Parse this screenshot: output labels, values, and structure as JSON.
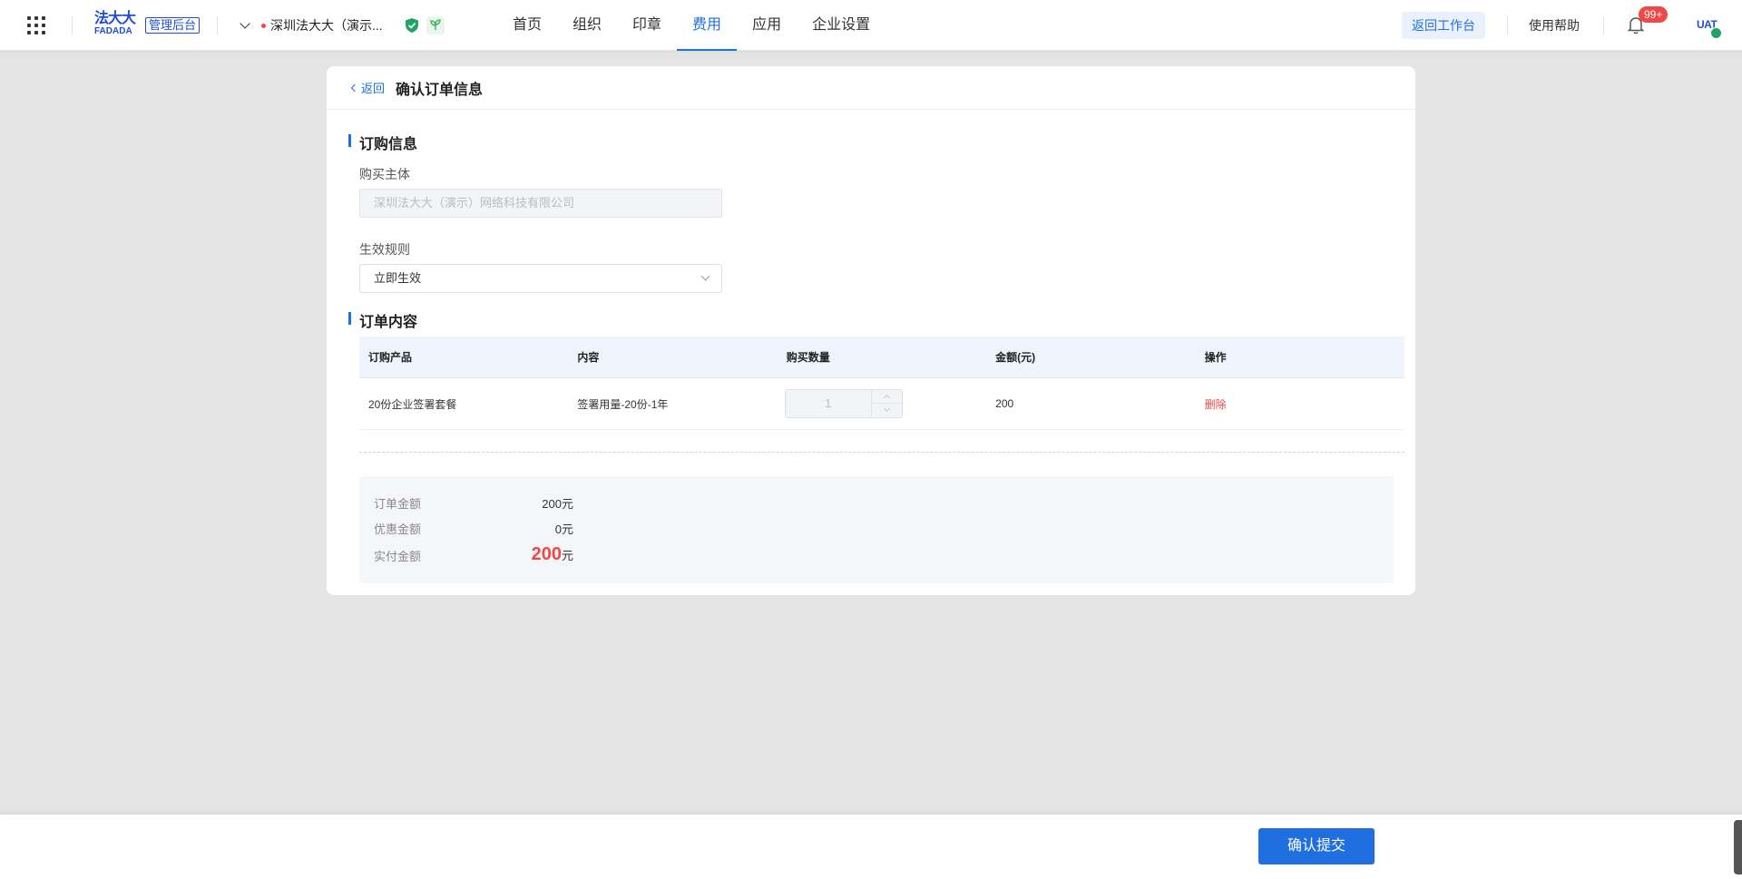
{
  "header": {
    "logo_cn": "法大大",
    "logo_en": "FADADA",
    "admin_tag": "管理后台",
    "company": "深圳法大大（演示...",
    "nav": [
      {
        "label": "首页",
        "active": false
      },
      {
        "label": "组织",
        "active": false
      },
      {
        "label": "印章",
        "active": false
      },
      {
        "label": "费用",
        "active": true
      },
      {
        "label": "应用",
        "active": false
      },
      {
        "label": "企业设置",
        "active": false
      }
    ],
    "back_workspace": "返回工作台",
    "help": "使用帮助",
    "notification_count": "99+",
    "avatar_text": "UAT"
  },
  "page": {
    "back_label": "返回",
    "title": "确认订单信息"
  },
  "order_info": {
    "section_title": "订购信息",
    "buyer_label": "购买主体",
    "buyer_placeholder": "深圳法大大（演示）网络科技有限公司",
    "rule_label": "生效规则",
    "rule_value": "立即生效"
  },
  "order_content": {
    "section_title": "订单内容",
    "columns": [
      "订购产品",
      "内容",
      "购买数量",
      "金额(元)",
      "操作"
    ],
    "rows": [
      {
        "product": "20份企业签署套餐",
        "content": "签署用量-20份-1年",
        "quantity": "1",
        "amount": "200",
        "action": "删除"
      }
    ]
  },
  "summary": {
    "order_amount_label": "订单金额",
    "order_amount": "200元",
    "discount_label": "优惠金额",
    "discount": "0元",
    "paid_label": "实付金额",
    "paid_value": "200",
    "paid_unit": "元"
  },
  "footer": {
    "submit_label": "确认提交"
  },
  "colors": {
    "primary": "#1f6fe0",
    "danger": "#f04848",
    "brand": "#1f4fd1"
  }
}
